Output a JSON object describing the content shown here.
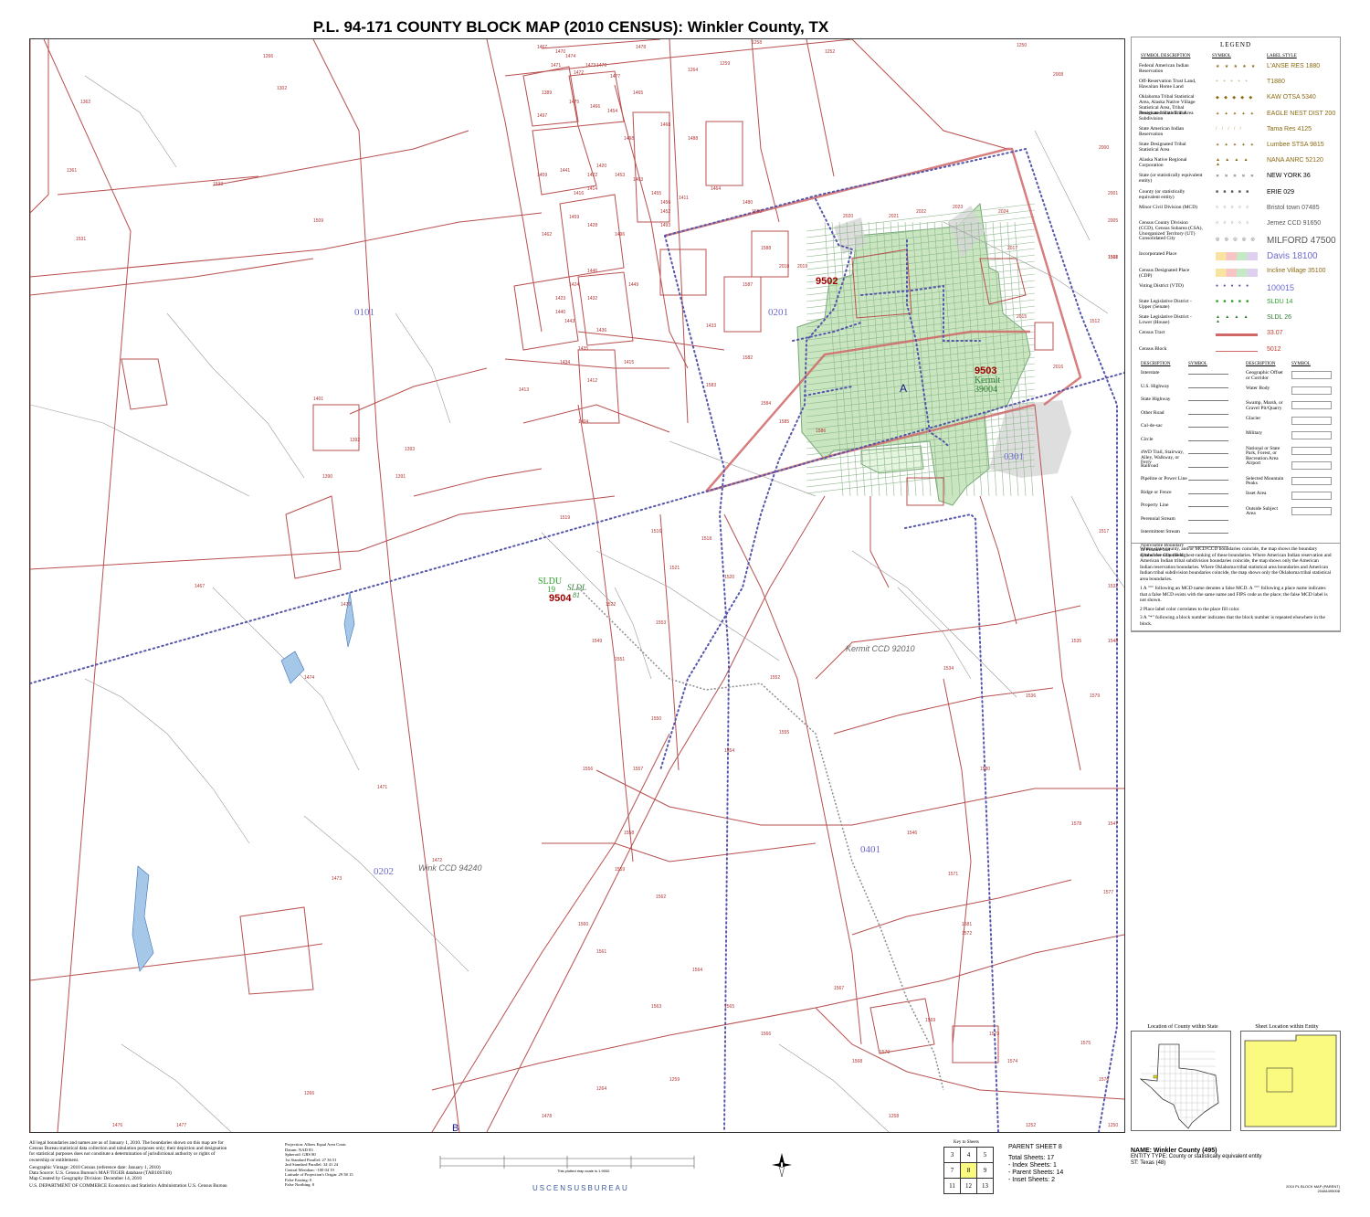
{
  "title": "P.L. 94-171 COUNTY BLOCK MAP (2010 CENSUS):  Winkler County, TX",
  "map": {
    "tracts": [
      {
        "label": "0101",
        "color": "#6a6acd"
      },
      {
        "label": "0201",
        "color": "#6a6acd"
      },
      {
        "label": "0202",
        "color": "#6a6acd"
      },
      {
        "label": "0301",
        "color": "#6a6acd"
      },
      {
        "label": "0401",
        "color": "#6a6acd"
      }
    ],
    "vtds": [
      "9502",
      "9503",
      "9504"
    ],
    "place": {
      "name": "Kermit",
      "code": "39004"
    },
    "ccds": [
      "Kermit CCD 92010",
      "Wink CCD 94240"
    ],
    "sldu": {
      "label": "SLDU",
      "number": "19"
    },
    "sldl": {
      "label": "SLDL",
      "number": "81"
    },
    "inset_marks": [
      "A",
      "B"
    ],
    "blocks": [
      "1467",
      "1470",
      "1474",
      "1471",
      "1472",
      "1473",
      "1476",
      "1477",
      "1266",
      "1478",
      "1264",
      "1259",
      "1258",
      "1252",
      "1250",
      "1302",
      "1362",
      "1361",
      "1389",
      "1475",
      "1466",
      "1454",
      "1465",
      "1468",
      "1488",
      "1497",
      "1498",
      "1441",
      "1422",
      "1420",
      "1453",
      "1409",
      "1414",
      "1416",
      "1463",
      "1455",
      "1411",
      "1456",
      "1452",
      "1464",
      "1480",
      "1459",
      "1462",
      "1428",
      "1496",
      "1493",
      "1449",
      "1433",
      "1446",
      "1424",
      "1423",
      "1432",
      "1440",
      "1443",
      "1436",
      "1435",
      "1434",
      "1412",
      "1415",
      "1413",
      "1404",
      "1401",
      "1392",
      "1393",
      "1390",
      "1391",
      "1519",
      "1516",
      "1518",
      "1520",
      "1521",
      "1522",
      "1549",
      "1551",
      "1550",
      "1552",
      "1553",
      "1554",
      "1555",
      "1556",
      "1557",
      "1558",
      "1559",
      "1560",
      "1561",
      "1562",
      "1563",
      "1564",
      "1565",
      "1566",
      "1567",
      "1568",
      "1569",
      "1570",
      "1571",
      "1572",
      "1573",
      "1574",
      "1575",
      "1576",
      "1577",
      "1578",
      "1579",
      "1580",
      "1581",
      "1582",
      "1583",
      "1584",
      "1585",
      "1586",
      "1587",
      "1588",
      "1589",
      "2018",
      "2019",
      "2020",
      "2021",
      "2022",
      "2023",
      "2024",
      "2017",
      "2015",
      "2016",
      "2001",
      "2005",
      "2008",
      "2000",
      "1508",
      "1511",
      "1512",
      "1517",
      "1532",
      "1535",
      "1536",
      "1534",
      "1546",
      "1548",
      "1547",
      "1531",
      "1533",
      "1509"
    ]
  },
  "legend": {
    "heading": "LEGEND",
    "col_headers": [
      "SYMBOL DESCRIPTION",
      "SYMBOL",
      "LABEL STYLE"
    ],
    "rows": [
      {
        "desc": "Federal American Indian Reservation",
        "label": "L'ANSE RES 1880",
        "color": "#8b6914"
      },
      {
        "desc": "Off-Reservation Trust Land, Hawaiian Home Land",
        "label": "T1880",
        "color": "#8b6914"
      },
      {
        "desc": "Oklahoma Tribal Statistical Area, Alaska Native Village Statistical Area, Tribal Designated Statistical Area",
        "label": "KAW OTSA 5340",
        "color": "#8b6914"
      },
      {
        "desc": "American Indian Tribal Subdivision",
        "label": "EAGLE NEST DIST 200",
        "color": "#8b6914"
      },
      {
        "desc": "State American Indian Reservation",
        "label": "Tama Res 4125",
        "color": "#8b6914"
      },
      {
        "desc": "State Designated Tribal Statistical Area",
        "label": "Lumbee STSA 9815",
        "color": "#8b6914"
      },
      {
        "desc": "Alaska Native Regional Corporation",
        "label": "NANA ANRC 52120",
        "color": "#8b6914"
      },
      {
        "desc": "State (or statistically equivalent entity)",
        "label": "NEW YORK 36",
        "color": "#000"
      },
      {
        "desc": "County (or statistically equivalent entity)",
        "label": "ERIE 029",
        "color": "#000"
      },
      {
        "desc": "Minor Civil Division (MCD)",
        "label": "Bristol town 07485",
        "color": "#555"
      },
      {
        "desc": "Census County Division (CCD), Census Subarea (CSA), Unorganized Territory (UT)",
        "label": "Jemez CCD 91650",
        "color": "#555"
      },
      {
        "desc": "Consolidated City",
        "label": "MILFORD 47500",
        "color": "#555"
      },
      {
        "desc": "Incorporated Place",
        "label": "Davis 18100",
        "color": "#6a6acd"
      },
      {
        "desc": "Census Designated Place (CDP)",
        "label": "Incline Village 35100",
        "color": "#8b6914"
      },
      {
        "desc": "Voting District (VTD)",
        "label": "100015",
        "color": "#6a6acd"
      },
      {
        "desc": "State Legislative District - Upper (Senate)",
        "label": "SLDU 14",
        "color": "#2ca02c"
      },
      {
        "desc": "State Legislative District - Lower (House)",
        "label": "SLDL 26",
        "color": "#2e7d32"
      },
      {
        "desc": "Census Tract",
        "label": "33.07",
        "color": "#c0392b"
      },
      {
        "desc": "Census Block",
        "label": "5012",
        "color": "#c0392b"
      }
    ],
    "features_left": [
      "Interstate",
      "U.S. Highway",
      "State Highway",
      "Other Road",
      "Cul-de-sac",
      "Circle",
      "4WD Trail, Stairway, Alley, Walkway, or Ferry",
      "Railroad",
      "Pipeline or Power Line",
      "Ridge or Fence",
      "Property Line",
      "Perennial Stream",
      "Intermittent Stream",
      "Nonvisible Boundary or Feature Not Elsewhere Classified"
    ],
    "features_right": [
      "Geographic Offset or Corridor",
      "Water Body",
      "Swamp, Marsh, or Gravel Pit/Quarry",
      "Glacier",
      "Military",
      "National or State Park, Forest, or Recreation Area",
      "Airport",
      "Selected Mountain Peaks",
      "Inset Area",
      "Outside Subject Area"
    ],
    "feature_headers": [
      "DESCRIPTION",
      "SYMBOL",
      "DESCRIPTION",
      "SYMBOL"
    ]
  },
  "notes": {
    "main": "Where state, county, and/or MCD/CCD boundaries coincide, the map shows the boundary symbol for only the highest-ranking of these boundaries. Where American Indian reservation and American Indian tribal subdivision boundaries coincide, the map shows only the American Indian reservation boundaries. Where Oklahoma tribal statistical area boundaries and American Indian tribal subdivision boundaries coincide, the map shows only the Oklahoma tribal statistical area boundaries.",
    "n1": "1  A \"°\" following an MCD name denotes a false MCD. A \"°\" following a place name indicates that a false MCD exists with the same name and FIPS code as the place; the false MCD label is not shown.",
    "n2": "2  Place label color correlates to the place fill color.",
    "n3": "3  A \"*\" following a block number indicates that the block number is repeated elsewhere in the block."
  },
  "insets": {
    "state_title": "Location of County within State",
    "sheet_title": "Sheet Location within Entity"
  },
  "footer": {
    "disclaimer": "All legal boundaries and names are as of January 1, 2010. The boundaries shown on this map are for Census Bureau statistical data collection and tabulation purposes only; their depiction and designation for statistical purposes does not constitute a determination of jurisdictional authority or rights of ownership or entitlement.",
    "vintage": "Geographic Vintage: 2010 Census (reference date: January 1, 2010)",
    "source": "Data Source: U.S. Census Bureau's MAF/TIGER database (TAB10ST48)",
    "created": "Map Created by Geography Division: December 14, 2010",
    "agency": "U.S. DEPARTMENT OF COMMERCE Economics and Statistics Administration U.S. Census Bureau",
    "projection": [
      "Projection: Albers Equal Area Conic",
      "Datum: NAD 83",
      "Spheroid: GRS 80",
      "1st Standard Parallel: 27 36 51",
      "2nd Standard Parallel: 34 41 24",
      "Central Meridian: -100 04 19",
      "Latitude of Projection's Origin: 29 58 15",
      "False Easting: 0",
      "False Northing: 0"
    ],
    "scale_note": "This plotted map scale is 1:9000",
    "census_logo": "USCENSUSBUREAU",
    "key_title": "Key to Sheets",
    "key_cells": [
      "3",
      "4",
      "5",
      "7",
      "8",
      "9",
      "11",
      "12",
      "13"
    ],
    "parent_sheet": "PARENT SHEET 8",
    "total_sheets": "Total Sheets: 17",
    "index_sheets": "- Index Sheets: 1",
    "parent_sheets": "- Parent Sheets: 14",
    "inset_sheets": "- Inset Sheets: 2",
    "name": "NAME: Winkler County (495)",
    "entity_type": "ENTITY TYPE: County or statistically equivalent entity",
    "state": "ST: Texas (48)",
    "sheet_code": "2010 PL BLOCK MAP (PARENT)",
    "sheet_id": "20484495008"
  }
}
